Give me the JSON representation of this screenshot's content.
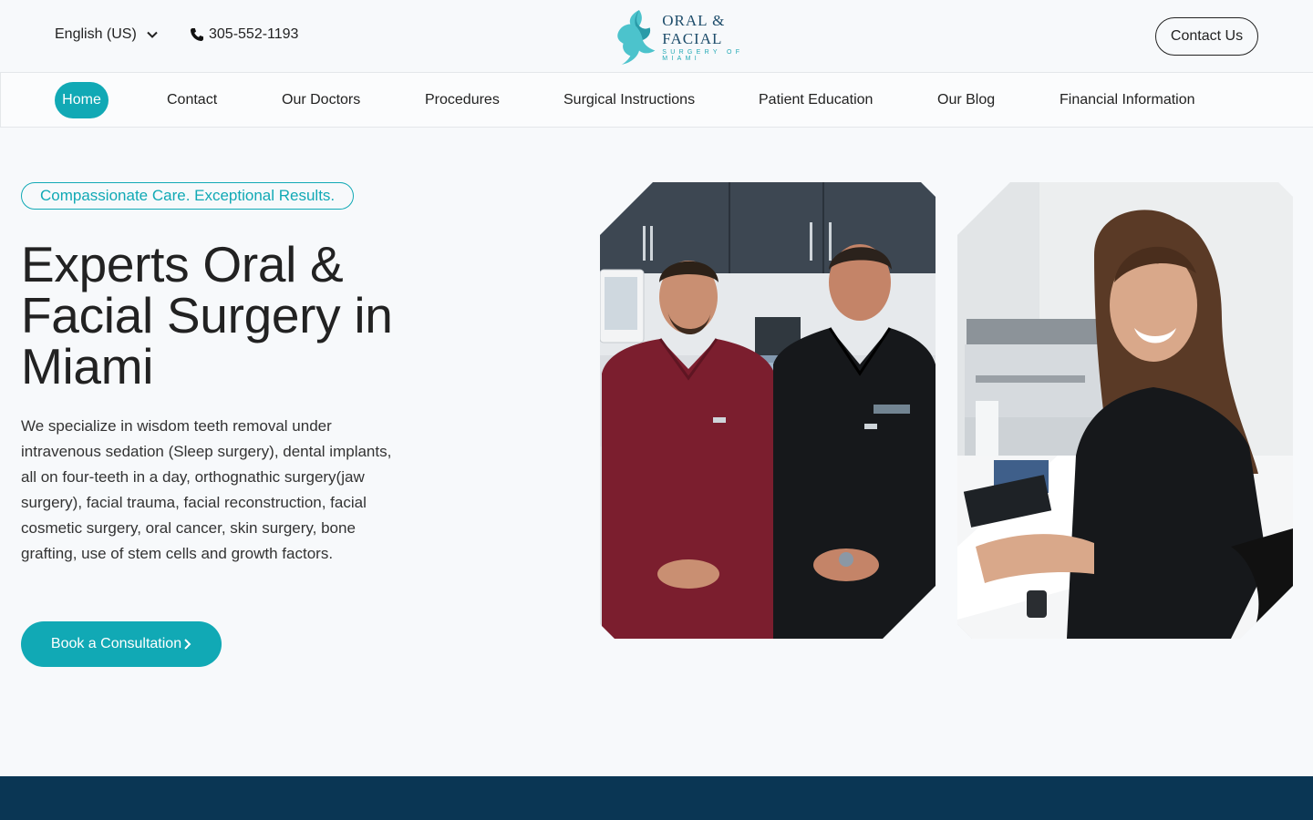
{
  "header": {
    "language": "English (US)",
    "phone": "305-552-1193",
    "logo": {
      "line1": "ORAL & FACIAL",
      "line2": "SURGERY OF MIAMI"
    },
    "contact_button": "Contact Us"
  },
  "nav": {
    "items": [
      {
        "label": "Home",
        "active": true
      },
      {
        "label": "Contact"
      },
      {
        "label": "Our Doctors"
      },
      {
        "label": "Procedures"
      },
      {
        "label": "Surgical Instructions"
      },
      {
        "label": "Patient Education"
      },
      {
        "label": "Our Blog"
      },
      {
        "label": "Financial Information"
      }
    ]
  },
  "hero": {
    "tagline": "Compassionate Care. Exceptional Results.",
    "headline": "Experts Oral & Facial Surgery in Miami",
    "description": "We specialize in wisdom teeth removal under intravenous sedation (Sleep surgery), dental implants, all on four-teeth in a day, orthognathic surgery(jaw surgery), facial trauma, facial reconstruction, facial cosmetic surgery, oral cancer, skin surgery, bone grafting, use of stem cells and growth factors.",
    "cta": "Book a Consultation"
  },
  "colors": {
    "accent": "#11a9b5",
    "dark_band": "#0a3654",
    "logo_navy": "#1e4d6b"
  },
  "icons": {
    "language_chevron": "chevron-down-icon",
    "phone": "phone-icon",
    "cta_arrow": "chevron-right-icon"
  }
}
